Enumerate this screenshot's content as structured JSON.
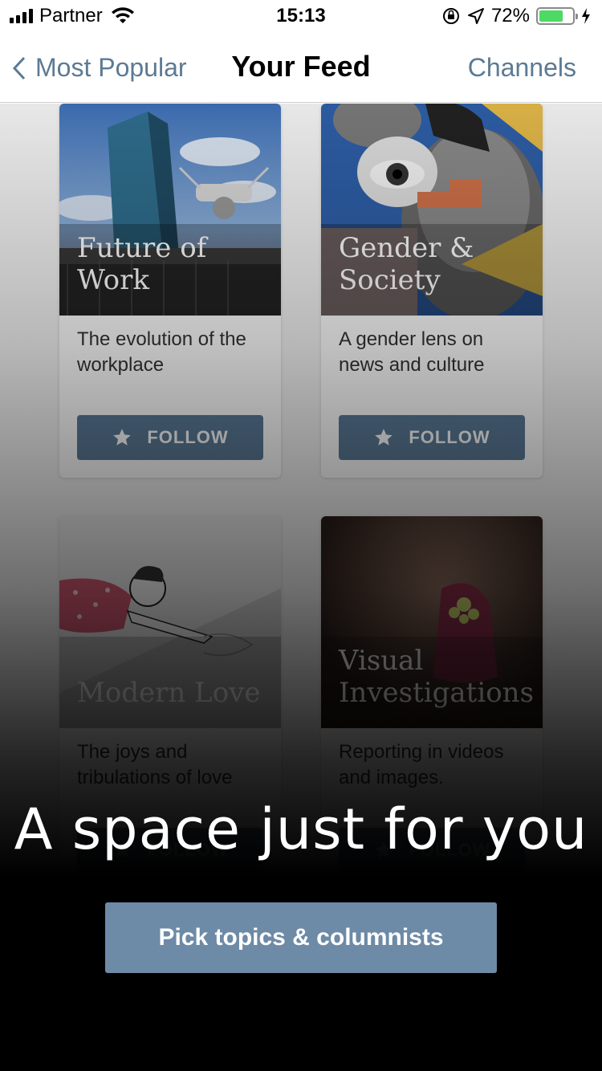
{
  "status_bar": {
    "carrier": "Partner",
    "time": "15:13",
    "battery_percent": "72%",
    "battery_level": 0.72,
    "icons": [
      "signal-icon",
      "wifi-icon",
      "orientation-lock-icon",
      "location-arrow-icon",
      "battery-icon",
      "charging-bolt-icon"
    ]
  },
  "nav": {
    "back_label": "Most Popular",
    "title": "Your Feed",
    "channels_label": "Channels"
  },
  "cards": [
    {
      "title": "Future of Work",
      "description": "The evolution of the workplace",
      "follow_label": "FOLLOW"
    },
    {
      "title": "Gender & Society",
      "description": "A gender lens on news and culture",
      "follow_label": "FOLLOW"
    },
    {
      "title": "Modern Love",
      "description": "The joys and tribulations of love",
      "follow_label": "FOLLOW"
    },
    {
      "title": "Visual Investigations",
      "description": "Reporting in videos and images.",
      "follow_label": "FOLLOW"
    }
  ],
  "overlay": {
    "headline": "A space just for you",
    "cta_label": "Pick topics & columnists"
  },
  "colors": {
    "accent": "#5c7a93",
    "follow_button": "#5b7b98",
    "cta_button": "#6d8aa6"
  }
}
